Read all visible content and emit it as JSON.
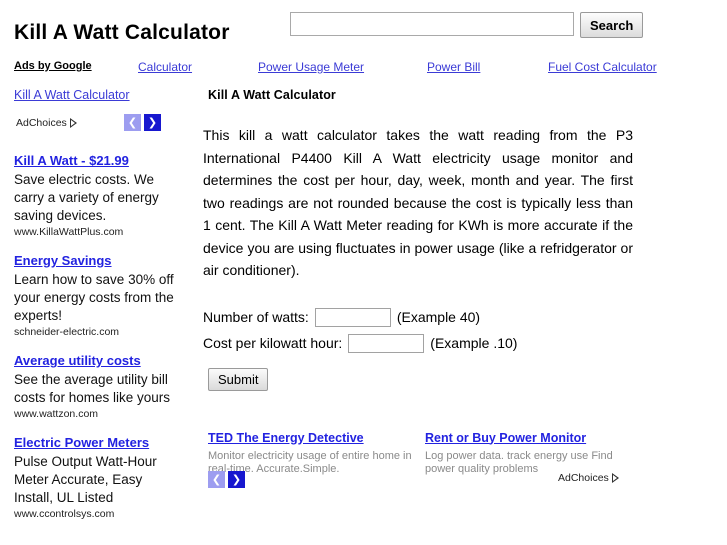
{
  "header": {
    "site_title": "Kill A Watt Calculator",
    "search": {
      "value": "",
      "placeholder": "",
      "button_label": "Search"
    }
  },
  "link_unit": {
    "label": "Ads by Google",
    "links": [
      "Calculator",
      "Power Usage Meter",
      "Power Bill",
      "Fuel Cost Calculator"
    ]
  },
  "sidebar": {
    "top_link": "Kill A Watt Calculator",
    "adchoices_label": "AdChoices",
    "prev_arrow": "❮",
    "next_arrow": "❯",
    "ads": [
      {
        "title": "Kill A Watt - $21.99",
        "desc": "Save electric costs. We carry a variety of energy saving devices.",
        "url": "www.KillaWattPlus.com"
      },
      {
        "title": "Energy Savings",
        "desc": "Learn how to save 30% off your energy costs from the experts!",
        "url": "schneider-electric.com"
      },
      {
        "title": "Average utility costs",
        "desc": "See the average utility bill costs for homes like yours",
        "url": "www.wattzon.com"
      },
      {
        "title": "Electric Power Meters",
        "desc": "Pulse Output Watt-Hour Meter Accurate, Easy Install, UL Listed",
        "url": "www.ccontrolsys.com"
      }
    ]
  },
  "main": {
    "title": "Kill A Watt Calculator",
    "intro": "This kill a watt calculator takes the watt reading from the P3 International P4400 Kill A Watt electricity usage monitor and determines the cost per hour, day, week, month and year. The first two readings are not rounded because the cost is typically less than 1 cent. The Kill A Watt Meter reading for KWh is more accurate if the device you are using fluctuates in power usage (like a refridgerator or air conditioner).",
    "form": {
      "watts_label": "Number of watts:",
      "watts_value": "",
      "watts_hint": "(Example 40)",
      "cost_label": "Cost per kilowatt hour:",
      "cost_value": "",
      "cost_hint": "(Example .10)",
      "submit_label": "Submit"
    },
    "bottom_ads": {
      "adchoices_label": "AdChoices",
      "prev_arrow": "❮",
      "next_arrow": "❯",
      "items": [
        {
          "title": "TED The Energy Detective",
          "desc": "Monitor electricity usage of entire home in real-time. Accurate.Simple."
        },
        {
          "title": "Rent or Buy Power Monitor",
          "desc": "Log power data. track energy use Find power quality problems"
        }
      ]
    }
  },
  "colors": {
    "link": "#2222e0",
    "link_unit": "#3b3bd6",
    "ad_desc_gray": "#8a8a8a",
    "arrow_prev_bg": "#9d9df0",
    "arrow_next_bg": "#1717cf"
  }
}
